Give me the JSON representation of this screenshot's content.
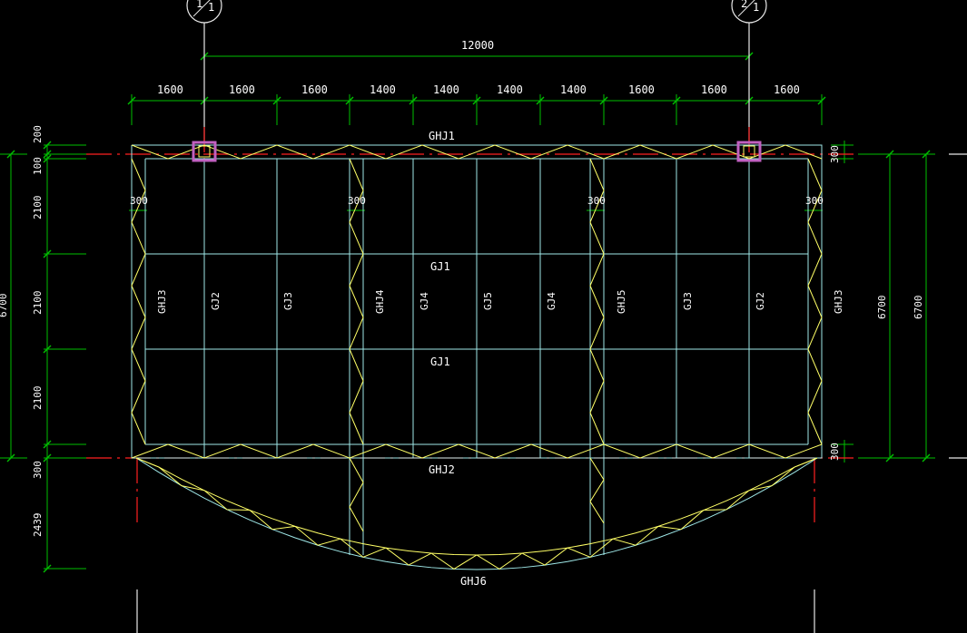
{
  "axes": [
    {
      "top": "1",
      "bottom": "1"
    },
    {
      "top": "2",
      "bottom": "1"
    }
  ],
  "overall_dimension": "12000",
  "top_dimensions": [
    "1600",
    "1600",
    "1600",
    "1400",
    "1400",
    "1400",
    "1400",
    "1600",
    "1600",
    "1600"
  ],
  "left_dimensions": [
    "200",
    "100",
    "2100",
    "2100",
    "2100",
    "300",
    "2439"
  ],
  "left_overall_dimension": "6700",
  "right_dimensions": [
    "300",
    "300"
  ],
  "right_overall_dimensions": [
    "6700",
    "6700"
  ],
  "inner_dimensions": [
    "300",
    "300",
    "300",
    "300"
  ],
  "member_labels": {
    "ghj1": "GHJ1",
    "ghj2": "GHJ2",
    "ghj6": "GHJ6",
    "gj1_upper": "GJ1",
    "gj1_lower": "GJ1",
    "vertical": [
      "GHJ3",
      "GJ2",
      "GJ3",
      "GHJ4",
      "GJ4",
      "GJ5",
      "GJ4",
      "GHJ5",
      "GJ3",
      "GJ2",
      "GHJ3"
    ]
  },
  "colors": {
    "background": "#000000",
    "dimension": "#00c000",
    "axis": "#ff2020",
    "grid": "#9fe8e8",
    "truss": "#ffff66",
    "column": "#c060c0"
  }
}
